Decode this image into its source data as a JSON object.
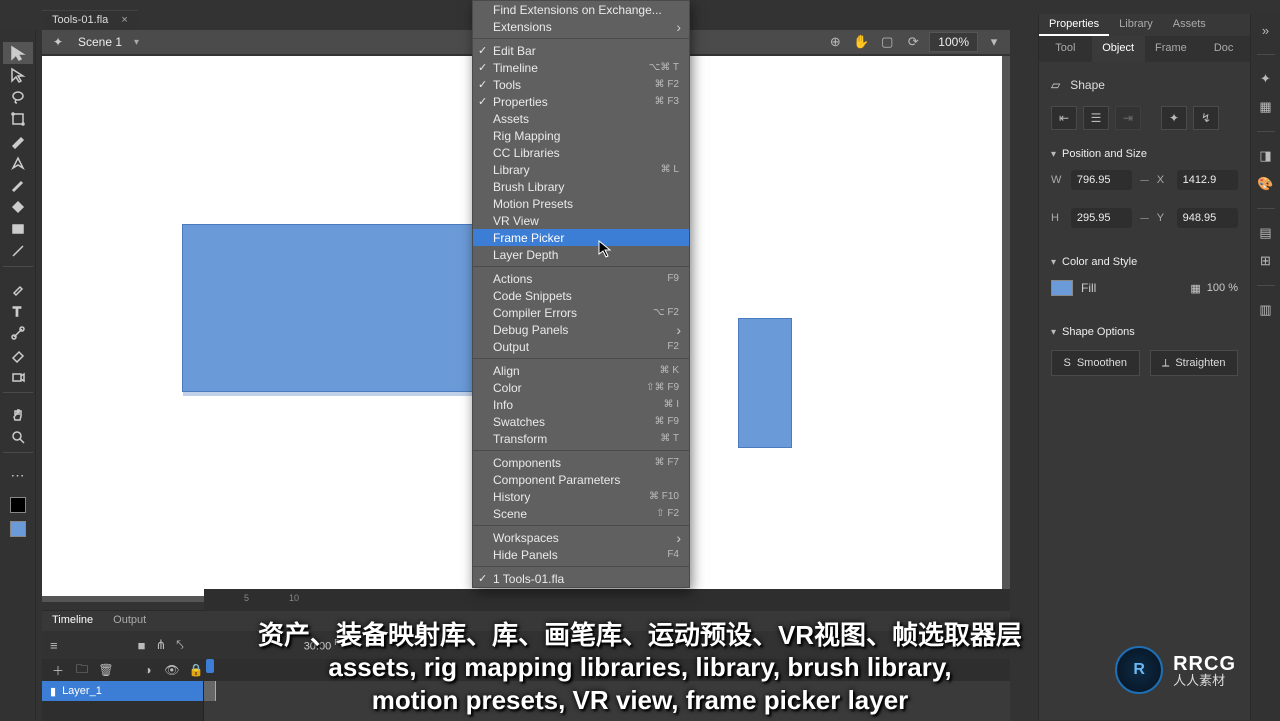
{
  "tab_title": "Tools-01.fla",
  "scene": {
    "name": "Scene 1"
  },
  "zoom": "100%",
  "menu": {
    "groups": [
      [
        {
          "label": "Find Extensions on Exchange..."
        },
        {
          "label": "Extensions",
          "sub": true
        }
      ],
      [
        {
          "label": "Edit Bar",
          "check": true
        },
        {
          "label": "Timeline",
          "check": true,
          "sc": "⌥⌘ T"
        },
        {
          "label": "Tools",
          "check": true,
          "sc": "⌘ F2"
        },
        {
          "label": "Properties",
          "check": true,
          "sc": "⌘ F3"
        },
        {
          "label": "Assets"
        },
        {
          "label": "Rig Mapping"
        },
        {
          "label": "CC Libraries"
        },
        {
          "label": "Library",
          "sc": "⌘ L"
        },
        {
          "label": "Brush Library"
        },
        {
          "label": "Motion Presets"
        },
        {
          "label": "VR View"
        },
        {
          "label": "Frame Picker",
          "hover": true
        },
        {
          "label": "Layer Depth"
        }
      ],
      [
        {
          "label": "Actions",
          "sc": "F9"
        },
        {
          "label": "Code Snippets"
        },
        {
          "label": "Compiler Errors",
          "sc": "⌥ F2"
        },
        {
          "label": "Debug Panels",
          "sub": true
        },
        {
          "label": "Output",
          "sc": "F2"
        }
      ],
      [
        {
          "label": "Align",
          "sc": "⌘ K"
        },
        {
          "label": "Color",
          "sc": "⇧⌘ F9"
        },
        {
          "label": "Info",
          "sc": "⌘ I"
        },
        {
          "label": "Swatches",
          "sc": "⌘ F9"
        },
        {
          "label": "Transform",
          "sc": "⌘ T"
        }
      ],
      [
        {
          "label": "Components",
          "sc": "⌘ F7"
        },
        {
          "label": "Component Parameters"
        },
        {
          "label": "History",
          "sc": "⌘ F10"
        },
        {
          "label": "Scene",
          "sc": "⇧ F2"
        }
      ],
      [
        {
          "label": "Workspaces",
          "sub": true
        },
        {
          "label": "Hide Panels",
          "sc": "F4"
        }
      ],
      [
        {
          "label": "1 Tools-01.fla",
          "check": true
        }
      ]
    ]
  },
  "properties": {
    "panel_tabs": [
      "Properties",
      "Library",
      "Assets"
    ],
    "sub_tabs": [
      "Tool",
      "Object",
      "Frame",
      "Doc"
    ],
    "shape_label": "Shape",
    "pos_size_hdr": "Position and Size",
    "w": "796.95",
    "x": "1412.9",
    "h": "295.95",
    "y": "948.95",
    "color_hdr": "Color and Style",
    "fill_label": "Fill",
    "opacity": "100 %",
    "shape_opts_hdr": "Shape Options",
    "smoothen": "Smoothen",
    "straighten": "Straighten"
  },
  "timeline": {
    "tabs": [
      "Timeline",
      "Output"
    ],
    "fps": "30.00",
    "layer": "Layer_1"
  },
  "subtitles": {
    "line1": "资产、装备映射库、库、画笔库、运动预设、VR视图、帧选取器层",
    "line2": "assets, rig mapping libraries, library, brush library,",
    "line3": "motion presets, VR view, frame picker layer"
  },
  "brand": {
    "t1": "RRCG",
    "t2": "人人素材"
  }
}
